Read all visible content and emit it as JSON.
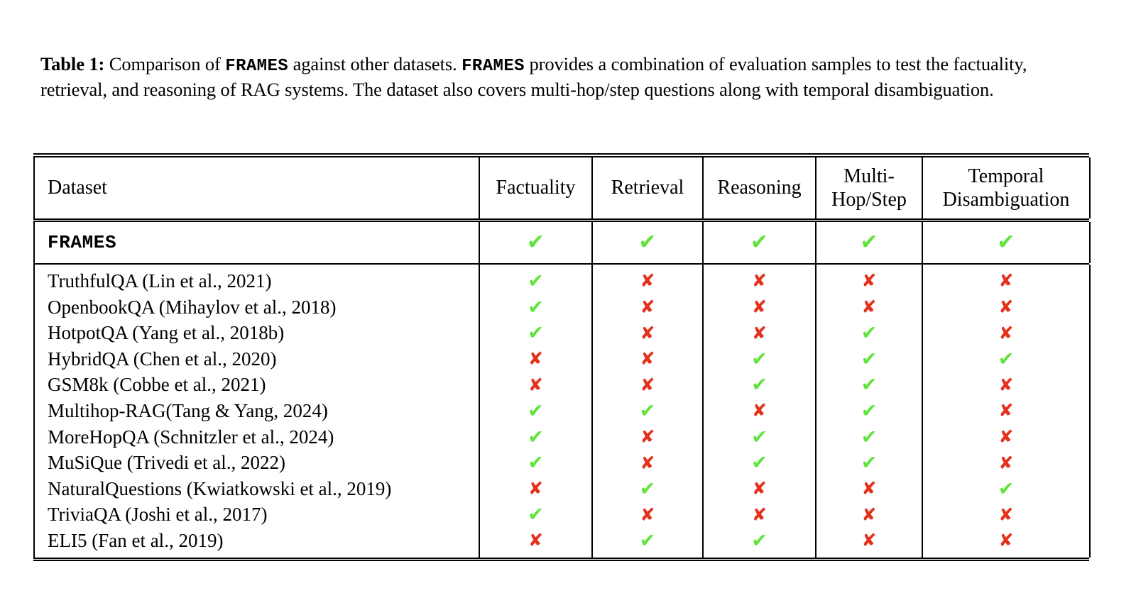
{
  "caption": {
    "label": "Table 1:",
    "part1": " Comparison of ",
    "brand1": "FRAMES",
    "part2": " against other datasets. ",
    "brand2": "FRAMES",
    "part3": " provides a combination of evaluation samples to test the factuality, retrieval, and reasoning of RAG systems. The dataset also covers multi-hop/step questions along with temporal disambiguation."
  },
  "colors": {
    "check": "#5FE43C",
    "cross": "#E5301C",
    "rule": "#000000",
    "background": "#FFFFFF"
  },
  "icons": {
    "check": "✔",
    "cross": "✘"
  },
  "table": {
    "columns": [
      {
        "key": "dataset",
        "label": "Dataset",
        "label_line2": ""
      },
      {
        "key": "factuality",
        "label": "Factuality",
        "label_line2": ""
      },
      {
        "key": "retrieval",
        "label": "Retrieval",
        "label_line2": ""
      },
      {
        "key": "reasoning",
        "label": "Reasoning",
        "label_line2": ""
      },
      {
        "key": "multihop",
        "label": "Multi-",
        "label_line2": "Hop/Step"
      },
      {
        "key": "temporal",
        "label": "Temporal",
        "label_line2": "Disambiguation"
      }
    ],
    "highlight_row": {
      "name": "FRAMES",
      "factuality": "yes",
      "retrieval": "yes",
      "reasoning": "yes",
      "multihop": "yes",
      "temporal": "yes"
    },
    "rows": [
      {
        "name": "TruthfulQA (Lin et al., 2021)",
        "factuality": "yes",
        "retrieval": "no",
        "reasoning": "no",
        "multihop": "no",
        "temporal": "no"
      },
      {
        "name": "OpenbookQA (Mihaylov et al., 2018)",
        "factuality": "yes",
        "retrieval": "no",
        "reasoning": "no",
        "multihop": "no",
        "temporal": "no"
      },
      {
        "name": "HotpotQA (Yang et al., 2018b)",
        "factuality": "yes",
        "retrieval": "no",
        "reasoning": "no",
        "multihop": "yes",
        "temporal": "no"
      },
      {
        "name": "HybridQA (Chen et al., 2020)",
        "factuality": "no",
        "retrieval": "no",
        "reasoning": "yes",
        "multihop": "yes",
        "temporal": "yes"
      },
      {
        "name": "GSM8k (Cobbe et al., 2021)",
        "factuality": "no",
        "retrieval": "no",
        "reasoning": "yes",
        "multihop": "yes",
        "temporal": "no"
      },
      {
        "name": "Multihop-RAG(Tang & Yang, 2024)",
        "factuality": "yes",
        "retrieval": "yes",
        "reasoning": "no",
        "multihop": "yes",
        "temporal": "no"
      },
      {
        "name": "MoreHopQA (Schnitzler et al., 2024)",
        "factuality": "yes",
        "retrieval": "no",
        "reasoning": "yes",
        "multihop": "yes",
        "temporal": "no"
      },
      {
        "name": "MuSiQue (Trivedi et al., 2022)",
        "factuality": "yes",
        "retrieval": "no",
        "reasoning": "yes",
        "multihop": "yes",
        "temporal": "no"
      },
      {
        "name": "NaturalQuestions (Kwiatkowski et al., 2019)",
        "factuality": "no",
        "retrieval": "yes",
        "reasoning": "no",
        "multihop": "no",
        "temporal": "yes"
      },
      {
        "name": "TriviaQA (Joshi et al., 2017)",
        "factuality": "yes",
        "retrieval": "no",
        "reasoning": "no",
        "multihop": "no",
        "temporal": "no"
      },
      {
        "name": "ELI5 (Fan et al., 2019)",
        "factuality": "no",
        "retrieval": "yes",
        "reasoning": "yes",
        "multihop": "no",
        "temporal": "no"
      }
    ]
  }
}
